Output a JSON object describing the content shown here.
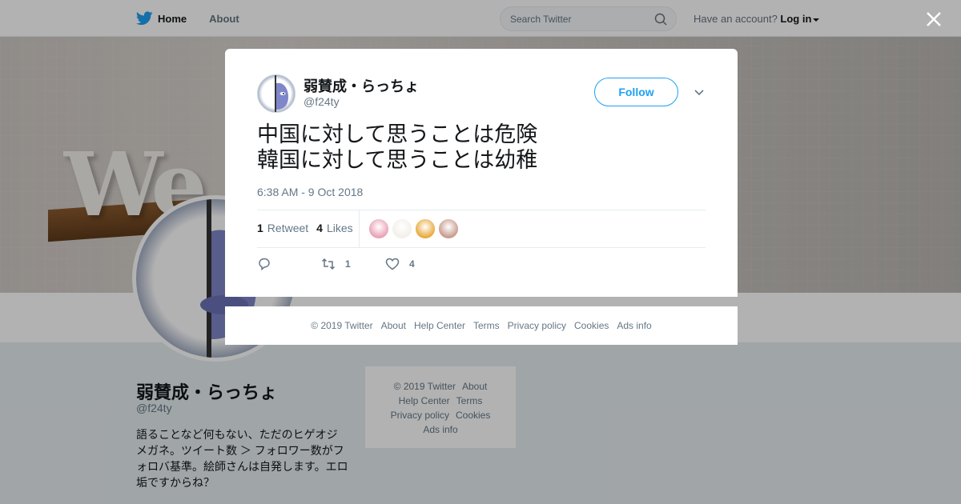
{
  "nav": {
    "home_label": "Home",
    "about_label": "About",
    "search_placeholder": "Search Twitter",
    "account_prompt": "Have an account?",
    "login_label": "Log in"
  },
  "profile": {
    "name": "弱賛成・らっちょ",
    "handle": "@f24ty",
    "bio": "語ることなど何もない、ただのヒゲオジメガネ。ツイート数 ＞ フォロワー数がフォロバ基準。絵師さんは自発します。エロ垢ですからね？"
  },
  "side_footer": {
    "copyright": "© 2019 Twitter",
    "about": "About",
    "help": "Help Center",
    "terms": "Terms",
    "privacy": "Privacy policy",
    "cookies": "Cookies",
    "ads": "Ads info"
  },
  "tweet": {
    "author_name": "弱賛成・らっちょ",
    "author_handle": "@f24ty",
    "follow_label": "Follow",
    "line1": "中国に対して思うことは危険",
    "line2": "韓国に対して思うことは幼稚",
    "timestamp": "6:38 AM - 9 Oct 2018",
    "retweet_count": "1",
    "retweet_label": "Retweet",
    "like_count": "4",
    "like_label": "Likes",
    "action_retweet_count": "1",
    "action_like_count": "4",
    "likers": [
      {
        "icon": "liker-avatar-1",
        "color": "#e9a0b5"
      },
      {
        "icon": "liker-avatar-2",
        "color": "#f3efe9"
      },
      {
        "icon": "liker-avatar-3",
        "color": "#e8a93a"
      },
      {
        "icon": "liker-avatar-4",
        "color": "#c79a8c"
      }
    ]
  },
  "modal_footer": {
    "copyright": "© 2019 Twitter",
    "about": "About",
    "help": "Help Center",
    "terms": "Terms",
    "privacy": "Privacy policy",
    "cookies": "Cookies",
    "ads": "Ads info"
  },
  "colors": {
    "brand_blue": "#1da1f2",
    "text_dark": "#14171a",
    "text_muted": "#657786"
  }
}
